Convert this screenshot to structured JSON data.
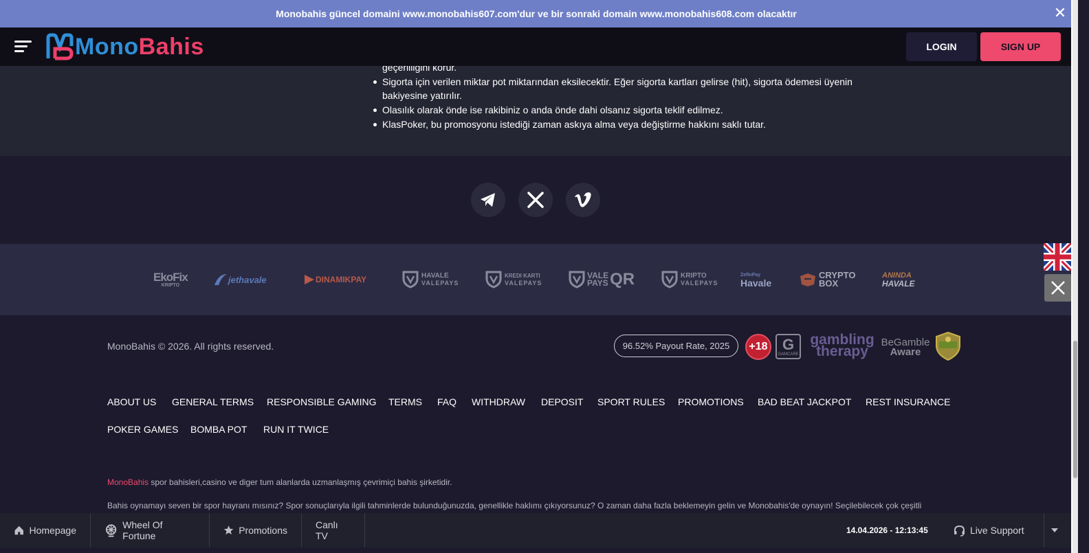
{
  "announcement": {
    "text": "Monobahis güncel domaini www.monobahis607.com'dur ve bir sonraki domain www.monobahis608.com olacaktır",
    "close_label": "✕"
  },
  "header": {
    "logo_text_a": "Mono",
    "logo_text_b": "Bahis",
    "login_label": "LOGIN",
    "signup_label": "SIGN UP"
  },
  "rules": [
    {
      "text": "geçerliliğini korur.",
      "bullet": false
    },
    {
      "text": "Sigorta için verilen miktar pot miktarından eksilecektir. Eğer sigorta kartları gelirse (hit), sigorta ödemesi üyenin bakiyesine yatırılır.",
      "bullet": true
    },
    {
      "text": "Olasılık olarak önde ise rakibiniz o anda önde dahi olsanız sigorta teklif edilmez.",
      "bullet": true
    },
    {
      "text": "KlasPoker, bu promosyonu istediği zaman askıya alma veya değiştirme hakkını saklı tutar.",
      "bullet": true
    }
  ],
  "social": [
    "telegram-icon",
    "x-icon",
    "vimeo-icon"
  ],
  "payments": {
    "ekofix_a": "EkoFix",
    "ekofix_b": "KRIPTO",
    "jethavale": "jethavale",
    "dinamikpay": "DINAMIKPAY",
    "havale_vp_a": "HAVALE",
    "havale_vp_b": "VALEPAYS",
    "kredi_vp_a": "KREDI KARTI",
    "kredi_vp_b": "VALEPAYS",
    "valepays_qr_a": "VALE",
    "valepays_qr_b": "PAYS",
    "valepays_qr_c": "QR",
    "kripto_vp_a": "KRIPTO",
    "kripto_vp_b": "VALEPAYS",
    "zefin_a": "ZefinPay",
    "zefin_b": "Havale",
    "cryptobox_a": "CRYPTO",
    "cryptobox_b": "BOX",
    "aninda_a": "ANINDA",
    "aninda_b": "HAVALE"
  },
  "footer": {
    "copyright": "MonoBahis © 2026. All rights reserved.",
    "payout": "96.52% Payout Rate, 2025",
    "age_badge": "+18",
    "gamcare_g": "G",
    "gamcare_t": "GAMCARE",
    "gambling_a": "gambling",
    "gambling_b": "therapy",
    "begamble_a": "BeGamble",
    "begamble_b": "Aware",
    "links": [
      "ABOUT US",
      "GENERAL TERMS",
      "RESPONSIBLE GAMING",
      "TERMS",
      "FAQ",
      "WITHDRAW",
      "DEPOSIT",
      "SPORT RULES",
      "PROMOTIONS",
      "BAD BEAT JACKPOT",
      "REST INSURANCE",
      "POKER GAMES",
      "BOMBA POT",
      "RUN IT TWICE"
    ],
    "about_brand": "MonoBahis",
    "about_rest": " spor bahisleri,casino ve diger tum alanlarda uzmanlaşmış çevrimiçi bahis şirketidir.",
    "about_text2": "Bahis oynamayı seven bir spor hayranı mısınız? Spor sonuçlarıyla ilgili tahminlerde bulunduğunuzda, genellikle haklımı çıkıyorsunuz? O zaman daha fazla beklemeyin gelin ve Monobahis'de oynayın! Seçilebilecek çok çeşitli"
  },
  "bottom_bar": {
    "homepage": "Homepage",
    "wheel": "Wheel Of Fortune",
    "promotions": "Promotions",
    "canli_tv": "Canlı TV",
    "datetime": "14.04.2026 - 12:13:45",
    "live_support": "Live Support"
  },
  "colors": {
    "announcement_bg": "#6e7fc7",
    "header_bg": "#0f0e17",
    "accent_pink": "#ee4a6e",
    "accent_blue": "#2f8fd8",
    "login_bg": "#1f1d36",
    "content_bg": "#252633",
    "footer_bg": "#1c1a2c",
    "payments_bg": "#2c2b44"
  }
}
